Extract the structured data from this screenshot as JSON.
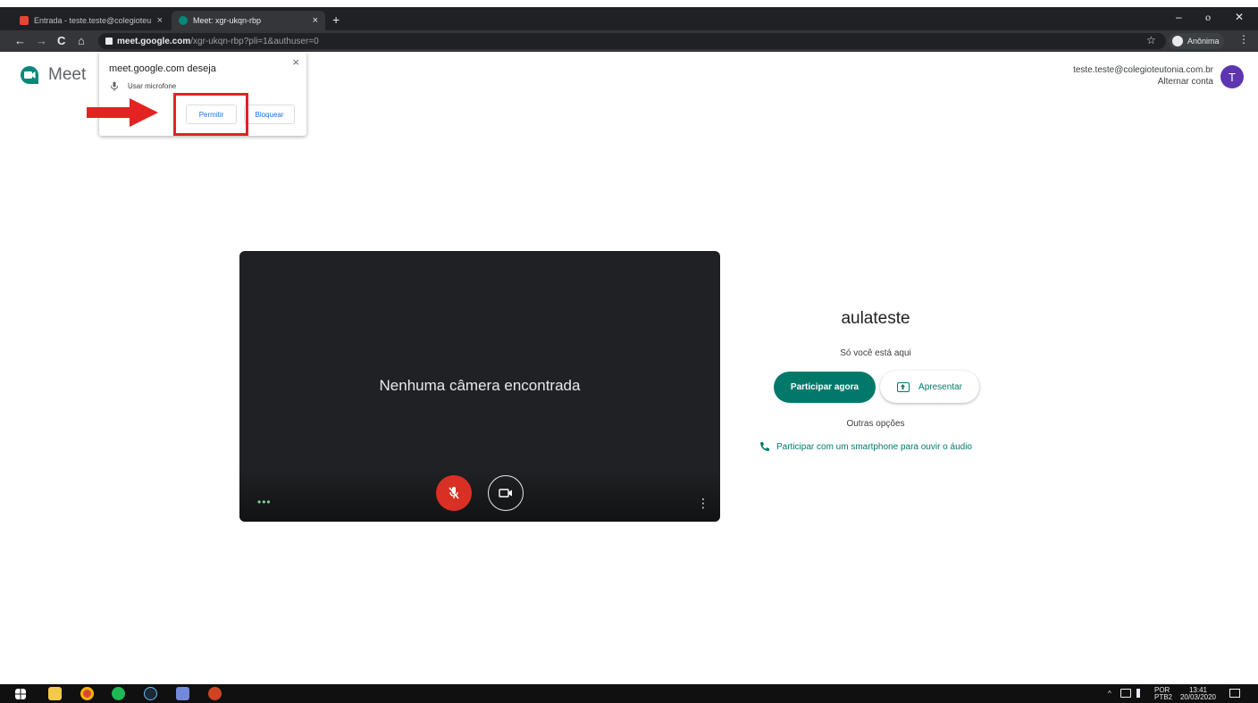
{
  "browser": {
    "tabs": [
      {
        "title": "Entrada - teste.teste@colegioteu",
        "close": "×"
      },
      {
        "title": "Meet: xgr-ukqn-rbp",
        "close": "×"
      }
    ],
    "new_tab": "+",
    "window_controls": {
      "minimize": "–",
      "restore": "ⲟ",
      "close": "✕"
    },
    "nav": {
      "back": "←",
      "forward": "→",
      "reload": "C",
      "home": "⌂"
    },
    "url_host": "meet.google.com",
    "url_path": "/xgr-ukqn-rbp?pli=1&authuser=0",
    "bookmark_star": "☆",
    "profile_label": "Anônima",
    "menu_glyph": "⋮"
  },
  "meet": {
    "logo_text": "Meet",
    "account_email": "teste.teste@colegioteutonia.com.br",
    "switch_account": "Alternar conta",
    "avatar_letter": "T"
  },
  "permission_popup": {
    "title": "meet.google.com deseja",
    "close": "×",
    "request": "Usar microfone",
    "allow_label": "Permitir",
    "block_label": "Bloquear"
  },
  "preview": {
    "no_camera": "Nenhuma câmera encontrada",
    "more_left": "•••",
    "more_right": "⋮"
  },
  "join_panel": {
    "room_name": "aulateste",
    "status": "Só você está aqui",
    "join_label": "Participar agora",
    "present_label": "Apresentar",
    "other_options": "Outras opções",
    "phone_audio": "Participar com um smartphone para ouvir o áudio"
  },
  "taskbar": {
    "tray_chevron": "^",
    "language": "POR",
    "layout": "PTB2",
    "time": "13:41",
    "date": "20/03/2020"
  },
  "colors": {
    "accent_teal": "#00796b",
    "mic_off_red": "#d93025",
    "annotation_red": "#e52222",
    "avatar_purple": "#5e35b1"
  }
}
